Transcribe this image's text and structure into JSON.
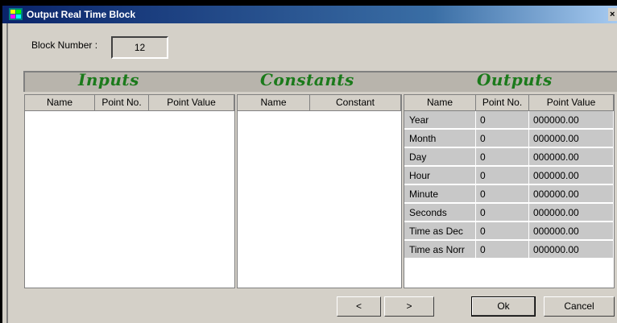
{
  "window": {
    "title": "Output Real Time Block",
    "close_glyph": "×"
  },
  "block": {
    "label": "Block Number :",
    "value": "12"
  },
  "sections": {
    "inputs_title": "Inputs",
    "constants_title": "Constants",
    "outputs_title": "Outputs"
  },
  "inputs": {
    "columns": [
      "Name",
      "Point No.",
      "Point Value"
    ]
  },
  "constants": {
    "columns": [
      "Name",
      "Constant"
    ]
  },
  "outputs": {
    "columns": [
      "Name",
      "Point No.",
      "Point Value"
    ],
    "rows": [
      {
        "name": "Year",
        "point_no": "0",
        "point_value": "000000.00"
      },
      {
        "name": "Month",
        "point_no": "0",
        "point_value": "000000.00"
      },
      {
        "name": "Day",
        "point_no": "0",
        "point_value": "000000.00"
      },
      {
        "name": "Hour",
        "point_no": "0",
        "point_value": "000000.00"
      },
      {
        "name": "Minute",
        "point_no": "0",
        "point_value": "000000.00"
      },
      {
        "name": "Seconds",
        "point_no": "0",
        "point_value": "000000.00"
      },
      {
        "name": "Time as Dec",
        "point_no": "0",
        "point_value": "000000.00"
      },
      {
        "name": "Time as Norr",
        "point_no": "0",
        "point_value": "000000.00"
      }
    ]
  },
  "buttons": {
    "prev": "<",
    "next": ">",
    "ok": "Ok",
    "cancel": "Cancel"
  },
  "colors": {
    "section_title": "#1b7a1b",
    "title_bar": "#0a246a",
    "dialog_bg": "#d4d0c8"
  }
}
